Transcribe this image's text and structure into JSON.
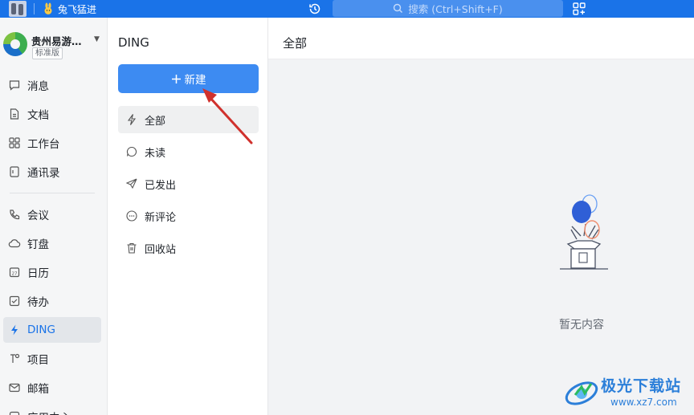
{
  "topbar": {
    "user_name": "兔飞猛进",
    "search_placeholder": "搜索 (Ctrl+Shift+F)"
  },
  "sidebar": {
    "org_name": "贵州易游…",
    "org_badge": "标准版",
    "items": [
      {
        "label": "消息",
        "icon": "message-icon"
      },
      {
        "label": "文档",
        "icon": "document-icon"
      },
      {
        "label": "工作台",
        "icon": "grid-icon"
      },
      {
        "label": "通讯录",
        "icon": "contacts-icon"
      },
      {
        "label": "会议",
        "icon": "phone-icon"
      },
      {
        "label": "钉盘",
        "icon": "cloud-icon"
      },
      {
        "label": "日历",
        "icon": "calendar-icon"
      },
      {
        "label": "待办",
        "icon": "checkbox-icon"
      },
      {
        "label": "DING",
        "icon": "lightning-icon",
        "active": true
      },
      {
        "label": "项目",
        "icon": "project-icon"
      },
      {
        "label": "邮箱",
        "icon": "mail-icon"
      },
      {
        "label": "应用中心",
        "icon": "apps-icon"
      }
    ]
  },
  "middle": {
    "title": "DING",
    "new_button": "新建",
    "filters": [
      {
        "label": "全部",
        "icon": "lightning-icon",
        "active": true
      },
      {
        "label": "未读",
        "icon": "chat-bubble-icon"
      },
      {
        "label": "已发出",
        "icon": "send-icon"
      },
      {
        "label": "新评论",
        "icon": "comment-icon"
      },
      {
        "label": "回收站",
        "icon": "trash-icon"
      }
    ]
  },
  "main": {
    "title": "全部",
    "empty_text": "暂无内容"
  },
  "watermark": {
    "name": "极光下载站",
    "url": "www.xz7.com"
  },
  "colors": {
    "accent": "#1a73e8",
    "button": "#3d8bf2",
    "annotation": "#d0312d"
  }
}
